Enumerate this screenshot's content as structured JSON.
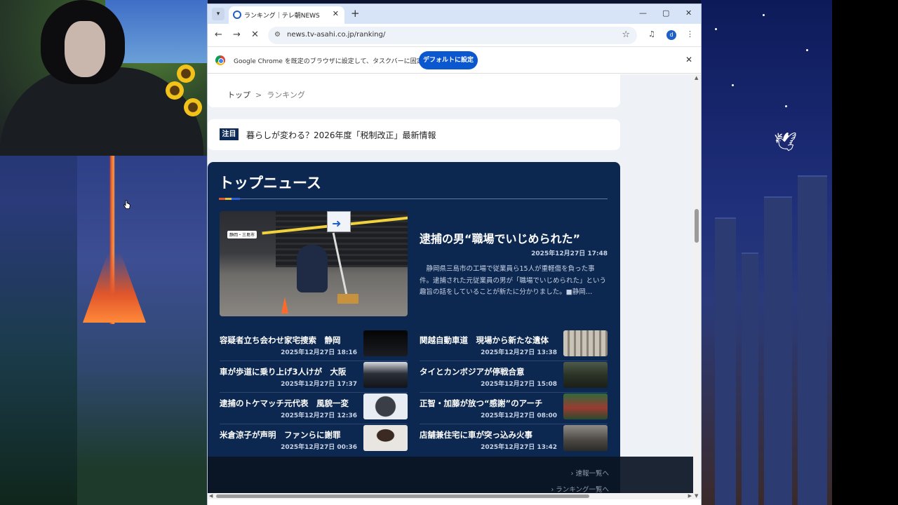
{
  "browser": {
    "tab_title": "ランキング｜テレ朝NEWS",
    "url": "news.tv-asahi.co.jp/ranking/",
    "profile_initial": "d",
    "infobar_text": "Google Chrome を既定のブラウザに設定して、タスクバーに固定する",
    "infobar_button": "デフォルトに設定"
  },
  "breadcrumb": {
    "home": "トップ",
    "separator": ">",
    "current": "ランキング"
  },
  "notice": {
    "tag": "注目",
    "text": "暮らしが変わる？2026年度「税制改正」最新情報"
  },
  "top_news": {
    "heading": "トップニュース",
    "lead": {
      "image_caption": "静岡・三島市",
      "title": "逮捕の男“職場でいじめられた”",
      "date": "2025年12月27日 17:48",
      "body": "　静岡県三島市の工場で従業員ら15人が重軽傷を負った事件。逮捕された元従業員の男が「職場でいじめられた」という趣旨の話をしていることが新たに分かりました。■静岡…"
    },
    "items": [
      {
        "title": "容疑者立ち会わせ家宅捜索　静岡",
        "date": "2025年12月27日 18:16"
      },
      {
        "title": "関越自動車道　現場から新たな遺体",
        "date": "2025年12月27日 13:38"
      },
      {
        "title": "車が歩道に乗り上げ3人けが　大阪",
        "date": "2025年12月27日 17:37"
      },
      {
        "title": "タイとカンボジアが停戦合意",
        "date": "2025年12月27日 15:08"
      },
      {
        "title": "逮捕のトケマッチ元代表　風貌一変",
        "date": "2025年12月27日 12:36"
      },
      {
        "title": "正智・加藤が放つ“感謝”のアーチ",
        "date": "2025年12月27日 08:00"
      },
      {
        "title": "米倉涼子が声明　ファンらに謝罪",
        "date": "2025年12月27日 00:36"
      },
      {
        "title": "店舗兼住宅に車が突っ込み火事",
        "date": "2025年12月27日 13:42"
      }
    ]
  },
  "footer_links": {
    "breaking": "› 速報一覧へ",
    "ranking": "› ランキング一覧へ"
  },
  "colors": {
    "news_bg": "#0d2850",
    "accent_button": "#0b57d0",
    "tag_bg": "#0e2a57"
  }
}
